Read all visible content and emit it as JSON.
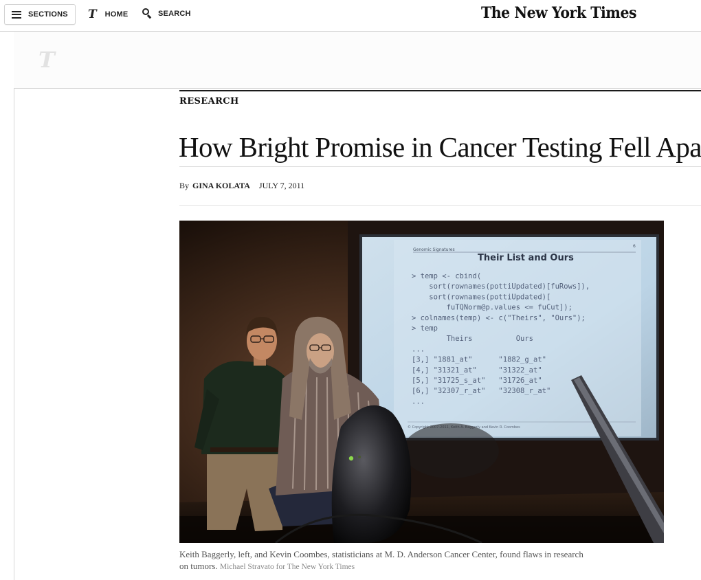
{
  "nav": {
    "sections_label": "SECTIONS",
    "home_label": "HOME",
    "search_label": "SEARCH",
    "masthead": "The New York Times"
  },
  "article": {
    "kicker": "RESEARCH",
    "headline": "How Bright Promise in Cancer Testing Fell Apart",
    "by_prefix": "By",
    "author": "GINA KOLATA",
    "date": "JULY 7, 2011",
    "caption": "Keith Baggerly, left, and Kevin Coombes, statisticians at M. D. Anderson Cancer Center, found flaws in research on tumors.",
    "credit": "Michael Stravato for The New York Times"
  },
  "slide": {
    "header_left": "Genomic Signatures",
    "header_right": "6",
    "title": "Their List and Ours",
    "code_lines": [
      "> temp <- cbind(",
      "    sort(rownames(pottiUpdated)[fuRows]),",
      "    sort(rownames(pottiUpdated)[",
      "        fuTQNorm@p.values <= fuCut]);",
      "> colnames(temp) <- c(\"Theirs\", \"Ours\");",
      "> temp",
      "        Theirs          Ours",
      "...",
      "[3,] \"1881_at\"      \"1882_g_at\"",
      "[4,] \"31321_at\"     \"31322_at\"",
      "[5,] \"31725_s_at\"   \"31726_at\"",
      "[6,] \"32307_r_at\"   \"32308_r_at\"",
      "..."
    ],
    "footer": "© Copyright 2007-2011, Keith A. Baggerly and Kevin R. Coombes"
  },
  "colors": {
    "text": "#121212",
    "rule": "#1a1a1a",
    "caption": "#555555",
    "credit": "#888888"
  }
}
